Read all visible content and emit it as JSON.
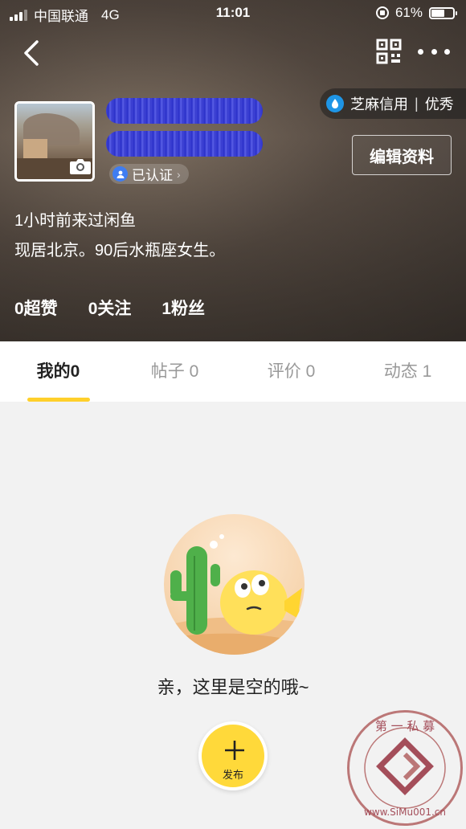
{
  "status_bar": {
    "carrier": "中国联通",
    "network": "4G",
    "time": "11:01",
    "battery_percent": "61%",
    "battery_level": 0.61
  },
  "header": {
    "credit_label": "芝麻信用",
    "credit_level": "优秀",
    "verified_label": "已认证",
    "edit_button": "编辑资料",
    "last_seen": "1小时前来过闲鱼",
    "bio": "现居北京。90后水瓶座女生。"
  },
  "stats": [
    {
      "label": "0超赞"
    },
    {
      "label": "0关注"
    },
    {
      "label": "1粉丝"
    }
  ],
  "tabs": [
    {
      "label": "我的0"
    },
    {
      "label": "帖子 0"
    },
    {
      "label": "评价 0"
    },
    {
      "label": "动态 1"
    }
  ],
  "empty_state": {
    "message": "亲，这里是空的哦~"
  },
  "publish_button": {
    "label": "发布"
  },
  "watermark": {
    "text_top": "第 一 私 募",
    "text_bottom": "www.SiMu001.cn"
  },
  "icons": {
    "back": "chevron-left-icon",
    "qr": "qr-code-icon",
    "more": "more-dots-icon",
    "credit": "sesame-credit-icon",
    "camera": "camera-icon",
    "verified": "verified-user-icon",
    "publish": "plus-icon"
  },
  "colors": {
    "accent_yellow": "#ffd93a",
    "tab_indicator": "#ffd02b",
    "credit_blue": "#1e95e6",
    "verified_blue": "#3f7df2"
  }
}
